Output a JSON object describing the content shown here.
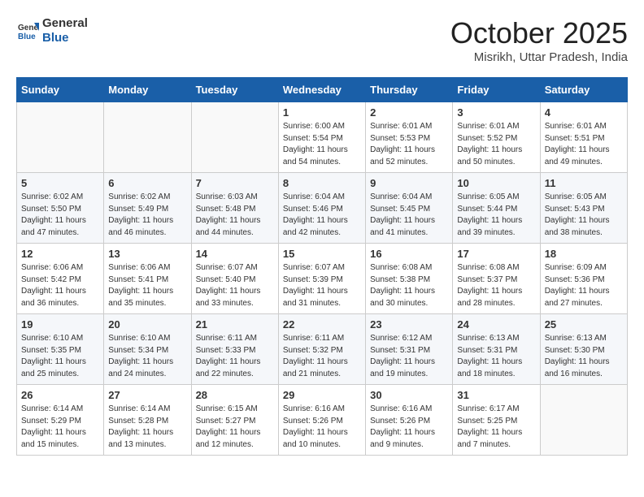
{
  "header": {
    "logo_line1": "General",
    "logo_line2": "Blue",
    "month": "October 2025",
    "location": "Misrikh, Uttar Pradesh, India"
  },
  "weekdays": [
    "Sunday",
    "Monday",
    "Tuesday",
    "Wednesday",
    "Thursday",
    "Friday",
    "Saturday"
  ],
  "weeks": [
    [
      {
        "day": "",
        "info": ""
      },
      {
        "day": "",
        "info": ""
      },
      {
        "day": "",
        "info": ""
      },
      {
        "day": "1",
        "info": "Sunrise: 6:00 AM\nSunset: 5:54 PM\nDaylight: 11 hours\nand 54 minutes."
      },
      {
        "day": "2",
        "info": "Sunrise: 6:01 AM\nSunset: 5:53 PM\nDaylight: 11 hours\nand 52 minutes."
      },
      {
        "day": "3",
        "info": "Sunrise: 6:01 AM\nSunset: 5:52 PM\nDaylight: 11 hours\nand 50 minutes."
      },
      {
        "day": "4",
        "info": "Sunrise: 6:01 AM\nSunset: 5:51 PM\nDaylight: 11 hours\nand 49 minutes."
      }
    ],
    [
      {
        "day": "5",
        "info": "Sunrise: 6:02 AM\nSunset: 5:50 PM\nDaylight: 11 hours\nand 47 minutes."
      },
      {
        "day": "6",
        "info": "Sunrise: 6:02 AM\nSunset: 5:49 PM\nDaylight: 11 hours\nand 46 minutes."
      },
      {
        "day": "7",
        "info": "Sunrise: 6:03 AM\nSunset: 5:48 PM\nDaylight: 11 hours\nand 44 minutes."
      },
      {
        "day": "8",
        "info": "Sunrise: 6:04 AM\nSunset: 5:46 PM\nDaylight: 11 hours\nand 42 minutes."
      },
      {
        "day": "9",
        "info": "Sunrise: 6:04 AM\nSunset: 5:45 PM\nDaylight: 11 hours\nand 41 minutes."
      },
      {
        "day": "10",
        "info": "Sunrise: 6:05 AM\nSunset: 5:44 PM\nDaylight: 11 hours\nand 39 minutes."
      },
      {
        "day": "11",
        "info": "Sunrise: 6:05 AM\nSunset: 5:43 PM\nDaylight: 11 hours\nand 38 minutes."
      }
    ],
    [
      {
        "day": "12",
        "info": "Sunrise: 6:06 AM\nSunset: 5:42 PM\nDaylight: 11 hours\nand 36 minutes."
      },
      {
        "day": "13",
        "info": "Sunrise: 6:06 AM\nSunset: 5:41 PM\nDaylight: 11 hours\nand 35 minutes."
      },
      {
        "day": "14",
        "info": "Sunrise: 6:07 AM\nSunset: 5:40 PM\nDaylight: 11 hours\nand 33 minutes."
      },
      {
        "day": "15",
        "info": "Sunrise: 6:07 AM\nSunset: 5:39 PM\nDaylight: 11 hours\nand 31 minutes."
      },
      {
        "day": "16",
        "info": "Sunrise: 6:08 AM\nSunset: 5:38 PM\nDaylight: 11 hours\nand 30 minutes."
      },
      {
        "day": "17",
        "info": "Sunrise: 6:08 AM\nSunset: 5:37 PM\nDaylight: 11 hours\nand 28 minutes."
      },
      {
        "day": "18",
        "info": "Sunrise: 6:09 AM\nSunset: 5:36 PM\nDaylight: 11 hours\nand 27 minutes."
      }
    ],
    [
      {
        "day": "19",
        "info": "Sunrise: 6:10 AM\nSunset: 5:35 PM\nDaylight: 11 hours\nand 25 minutes."
      },
      {
        "day": "20",
        "info": "Sunrise: 6:10 AM\nSunset: 5:34 PM\nDaylight: 11 hours\nand 24 minutes."
      },
      {
        "day": "21",
        "info": "Sunrise: 6:11 AM\nSunset: 5:33 PM\nDaylight: 11 hours\nand 22 minutes."
      },
      {
        "day": "22",
        "info": "Sunrise: 6:11 AM\nSunset: 5:32 PM\nDaylight: 11 hours\nand 21 minutes."
      },
      {
        "day": "23",
        "info": "Sunrise: 6:12 AM\nSunset: 5:31 PM\nDaylight: 11 hours\nand 19 minutes."
      },
      {
        "day": "24",
        "info": "Sunrise: 6:13 AM\nSunset: 5:31 PM\nDaylight: 11 hours\nand 18 minutes."
      },
      {
        "day": "25",
        "info": "Sunrise: 6:13 AM\nSunset: 5:30 PM\nDaylight: 11 hours\nand 16 minutes."
      }
    ],
    [
      {
        "day": "26",
        "info": "Sunrise: 6:14 AM\nSunset: 5:29 PM\nDaylight: 11 hours\nand 15 minutes."
      },
      {
        "day": "27",
        "info": "Sunrise: 6:14 AM\nSunset: 5:28 PM\nDaylight: 11 hours\nand 13 minutes."
      },
      {
        "day": "28",
        "info": "Sunrise: 6:15 AM\nSunset: 5:27 PM\nDaylight: 11 hours\nand 12 minutes."
      },
      {
        "day": "29",
        "info": "Sunrise: 6:16 AM\nSunset: 5:26 PM\nDaylight: 11 hours\nand 10 minutes."
      },
      {
        "day": "30",
        "info": "Sunrise: 6:16 AM\nSunset: 5:26 PM\nDaylight: 11 hours\nand 9 minutes."
      },
      {
        "day": "31",
        "info": "Sunrise: 6:17 AM\nSunset: 5:25 PM\nDaylight: 11 hours\nand 7 minutes."
      },
      {
        "day": "",
        "info": ""
      }
    ]
  ]
}
